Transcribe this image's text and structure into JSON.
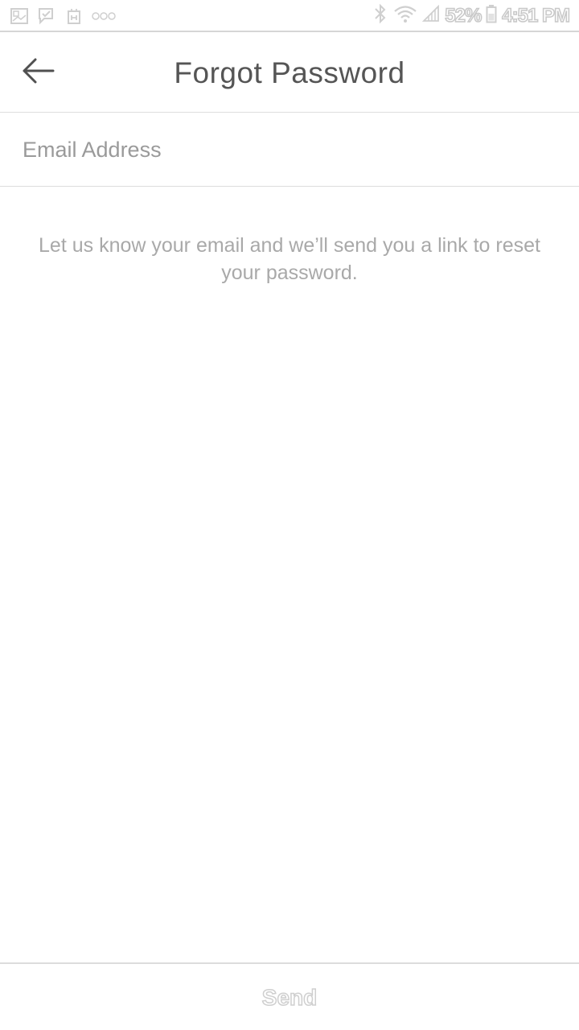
{
  "status_bar": {
    "notification_icons": [
      "gallery-icon",
      "check-message-icon",
      "app-notification-icon",
      "more-dots-icon"
    ],
    "bluetooth_icon": "bluetooth-icon",
    "wifi_icon": "wifi-icon",
    "signal_icon": "signal-icon",
    "battery_percent": "52%",
    "battery_icon": "battery-icon",
    "time": "4:51 PM"
  },
  "header": {
    "back_icon": "back-arrow-icon",
    "title": "Forgot Password"
  },
  "form": {
    "email_placeholder": "Email Address",
    "email_value": ""
  },
  "help_text": "Let us know your email and we’ll send you a link to reset your password.",
  "footer": {
    "send_label": "Send"
  },
  "colors": {
    "title": "#555555",
    "placeholder": "#9a9a9a",
    "help_text": "#a9a9a9",
    "divider": "#dcdcdc",
    "disabled": "#cfcfcf"
  }
}
